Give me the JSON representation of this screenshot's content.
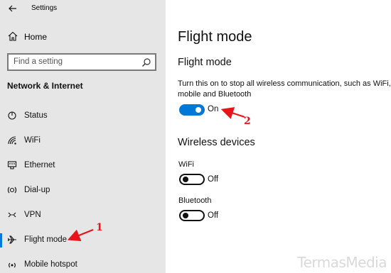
{
  "window": {
    "title": "Settings"
  },
  "sidebar": {
    "home_label": "Home",
    "search_placeholder": "Find a setting",
    "section_title": "Network & Internet",
    "items": [
      {
        "label": "Status",
        "icon": "status-icon"
      },
      {
        "label": "WiFi",
        "icon": "wifi-icon"
      },
      {
        "label": "Ethernet",
        "icon": "ethernet-icon"
      },
      {
        "label": "Dial-up",
        "icon": "dialup-icon"
      },
      {
        "label": "VPN",
        "icon": "vpn-icon"
      },
      {
        "label": "Flight mode",
        "icon": "airplane-icon",
        "active": true
      },
      {
        "label": "Mobile hotspot",
        "icon": "hotspot-icon"
      }
    ]
  },
  "main": {
    "page_title": "Flight mode",
    "flight_section_title": "Flight mode",
    "description": "Turn this on to stop all wireless communication, such as WiFi, mobile and Bluetooth",
    "flight_toggle": {
      "state": "On"
    },
    "wireless_title": "Wireless devices",
    "wifi": {
      "label": "WiFi",
      "state": "Off"
    },
    "bluetooth": {
      "label": "Bluetooth",
      "state": "Off"
    }
  },
  "annotations": {
    "one": "1",
    "two": "2"
  },
  "watermark": "TermasMedia",
  "colors": {
    "accent": "#0078d7",
    "sidebar_bg": "#e6e6e6",
    "annotation": "#e8141b"
  }
}
